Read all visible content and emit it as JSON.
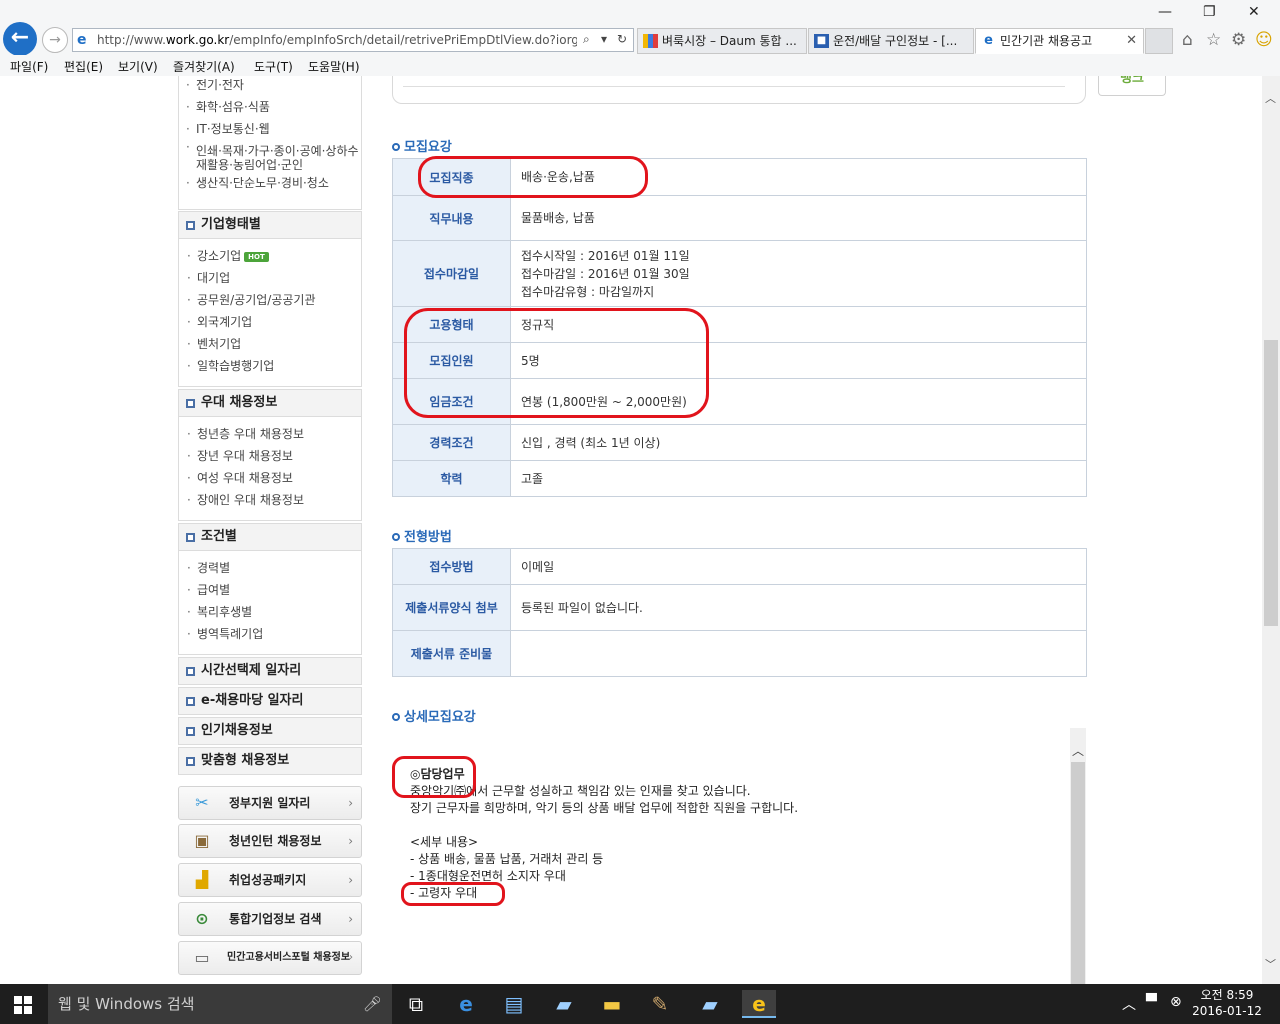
{
  "browser": {
    "url_prefix": "http://www.",
    "url_domain": "work.go.kr",
    "url_path": "/empInfo/empInfoSrch/detail/retrivePriEmpDtlView.do?iorgGbcd=C",
    "tabs": [
      {
        "label": "벼룩시장 – Daum 통합 ...",
        "active": false
      },
      {
        "label": "운전/배달 구인정보 - [...",
        "active": false
      },
      {
        "label": "민간기관 채용공고",
        "active": true
      }
    ],
    "menu": [
      "파일(F)",
      "편집(E)",
      "보기(V)",
      "즐겨찾기(A)",
      "도구(T)",
      "도움말(H)"
    ]
  },
  "sidebar": {
    "top_items": [
      "전기·전자",
      "화학·섬유·식품",
      "IT·정보통신·웹",
      "인쇄·목재·가구·종이·공예·상하수",
      "재활용·농림어업·군인",
      "생산직·단순노무·경비·청소"
    ],
    "company_type": {
      "title": "기업형태별",
      "items": [
        "강소기업",
        "대기업",
        "공무원/공기업/공공기관",
        "외국계기업",
        "벤처기업",
        "일학습병행기업"
      ],
      "hot_badge": "HOT"
    },
    "preferred": {
      "title": "우대 채용정보",
      "items": [
        "청년층 우대 채용정보",
        "장년 우대 채용정보",
        "여성 우대 채용정보",
        "장애인 우대 채용정보"
      ]
    },
    "condition": {
      "title": "조건별",
      "items": [
        "경력별",
        "급여별",
        "복리후생별",
        "병역특례기업"
      ]
    },
    "links": [
      "시간선택제 일자리",
      "e-채용마당 일자리",
      "인기채용정보",
      "맞춤형 채용정보"
    ],
    "buttons": [
      "정부지원 일자리",
      "청년인턴 채용정보",
      "취업성공패키지",
      "통합기업정보 검색",
      "민간고용서비스포털 채용정보"
    ]
  },
  "main": {
    "bank_label": "뱅크",
    "recruit": {
      "title": "모집요강",
      "rows": [
        {
          "label": "모집직종",
          "value": "배송·운송,납품"
        },
        {
          "label": "직무내용",
          "value": "물품배송, 납품"
        },
        {
          "label": "접수마감일",
          "lines": [
            "접수시작일 : 2016년 01월 11일",
            "접수마감일 : 2016년 01월 30일",
            "접수마감유형 : 마감일까지"
          ]
        },
        {
          "label": "고용형태",
          "value": "정규직"
        },
        {
          "label": "모집인원",
          "value": "5명"
        },
        {
          "label": "임금조건",
          "value": "연봉 (1,800만원 ~ 2,000만원)"
        },
        {
          "label": "경력조건",
          "value": "신입 , 경력 (최소 1년 이상)"
        },
        {
          "label": "학력",
          "value": "고졸"
        }
      ]
    },
    "selection": {
      "title": "전형방법",
      "rows": [
        {
          "label": "접수방법",
          "value": "이메일"
        },
        {
          "label": "제출서류양식 첨부",
          "value": "등록된 파일이 없습니다."
        },
        {
          "label": "제출서류 준비물",
          "value": ""
        }
      ]
    },
    "detail": {
      "title": "상세모집요강",
      "lines": [
        "◎담당업무",
        "중앙악기㈜에서 근무할 성실하고 책임감 있는 인재를 찾고 있습니다.",
        "장기 근무자를 희망하며, 악기 등의 상품 배달 업무에 적합한 직원을 구합니다.",
        "",
        "<세부 내용>",
        "- 상품 배송, 물품 납품, 거래처 관리 등",
        "- 1종대형운전면허 소지자 우대",
        "- 고령자 우대"
      ]
    }
  },
  "taskbar": {
    "search_placeholder": "웹 및 Windows 검색",
    "time": "오전 8:59",
    "date": "2016-01-12"
  }
}
